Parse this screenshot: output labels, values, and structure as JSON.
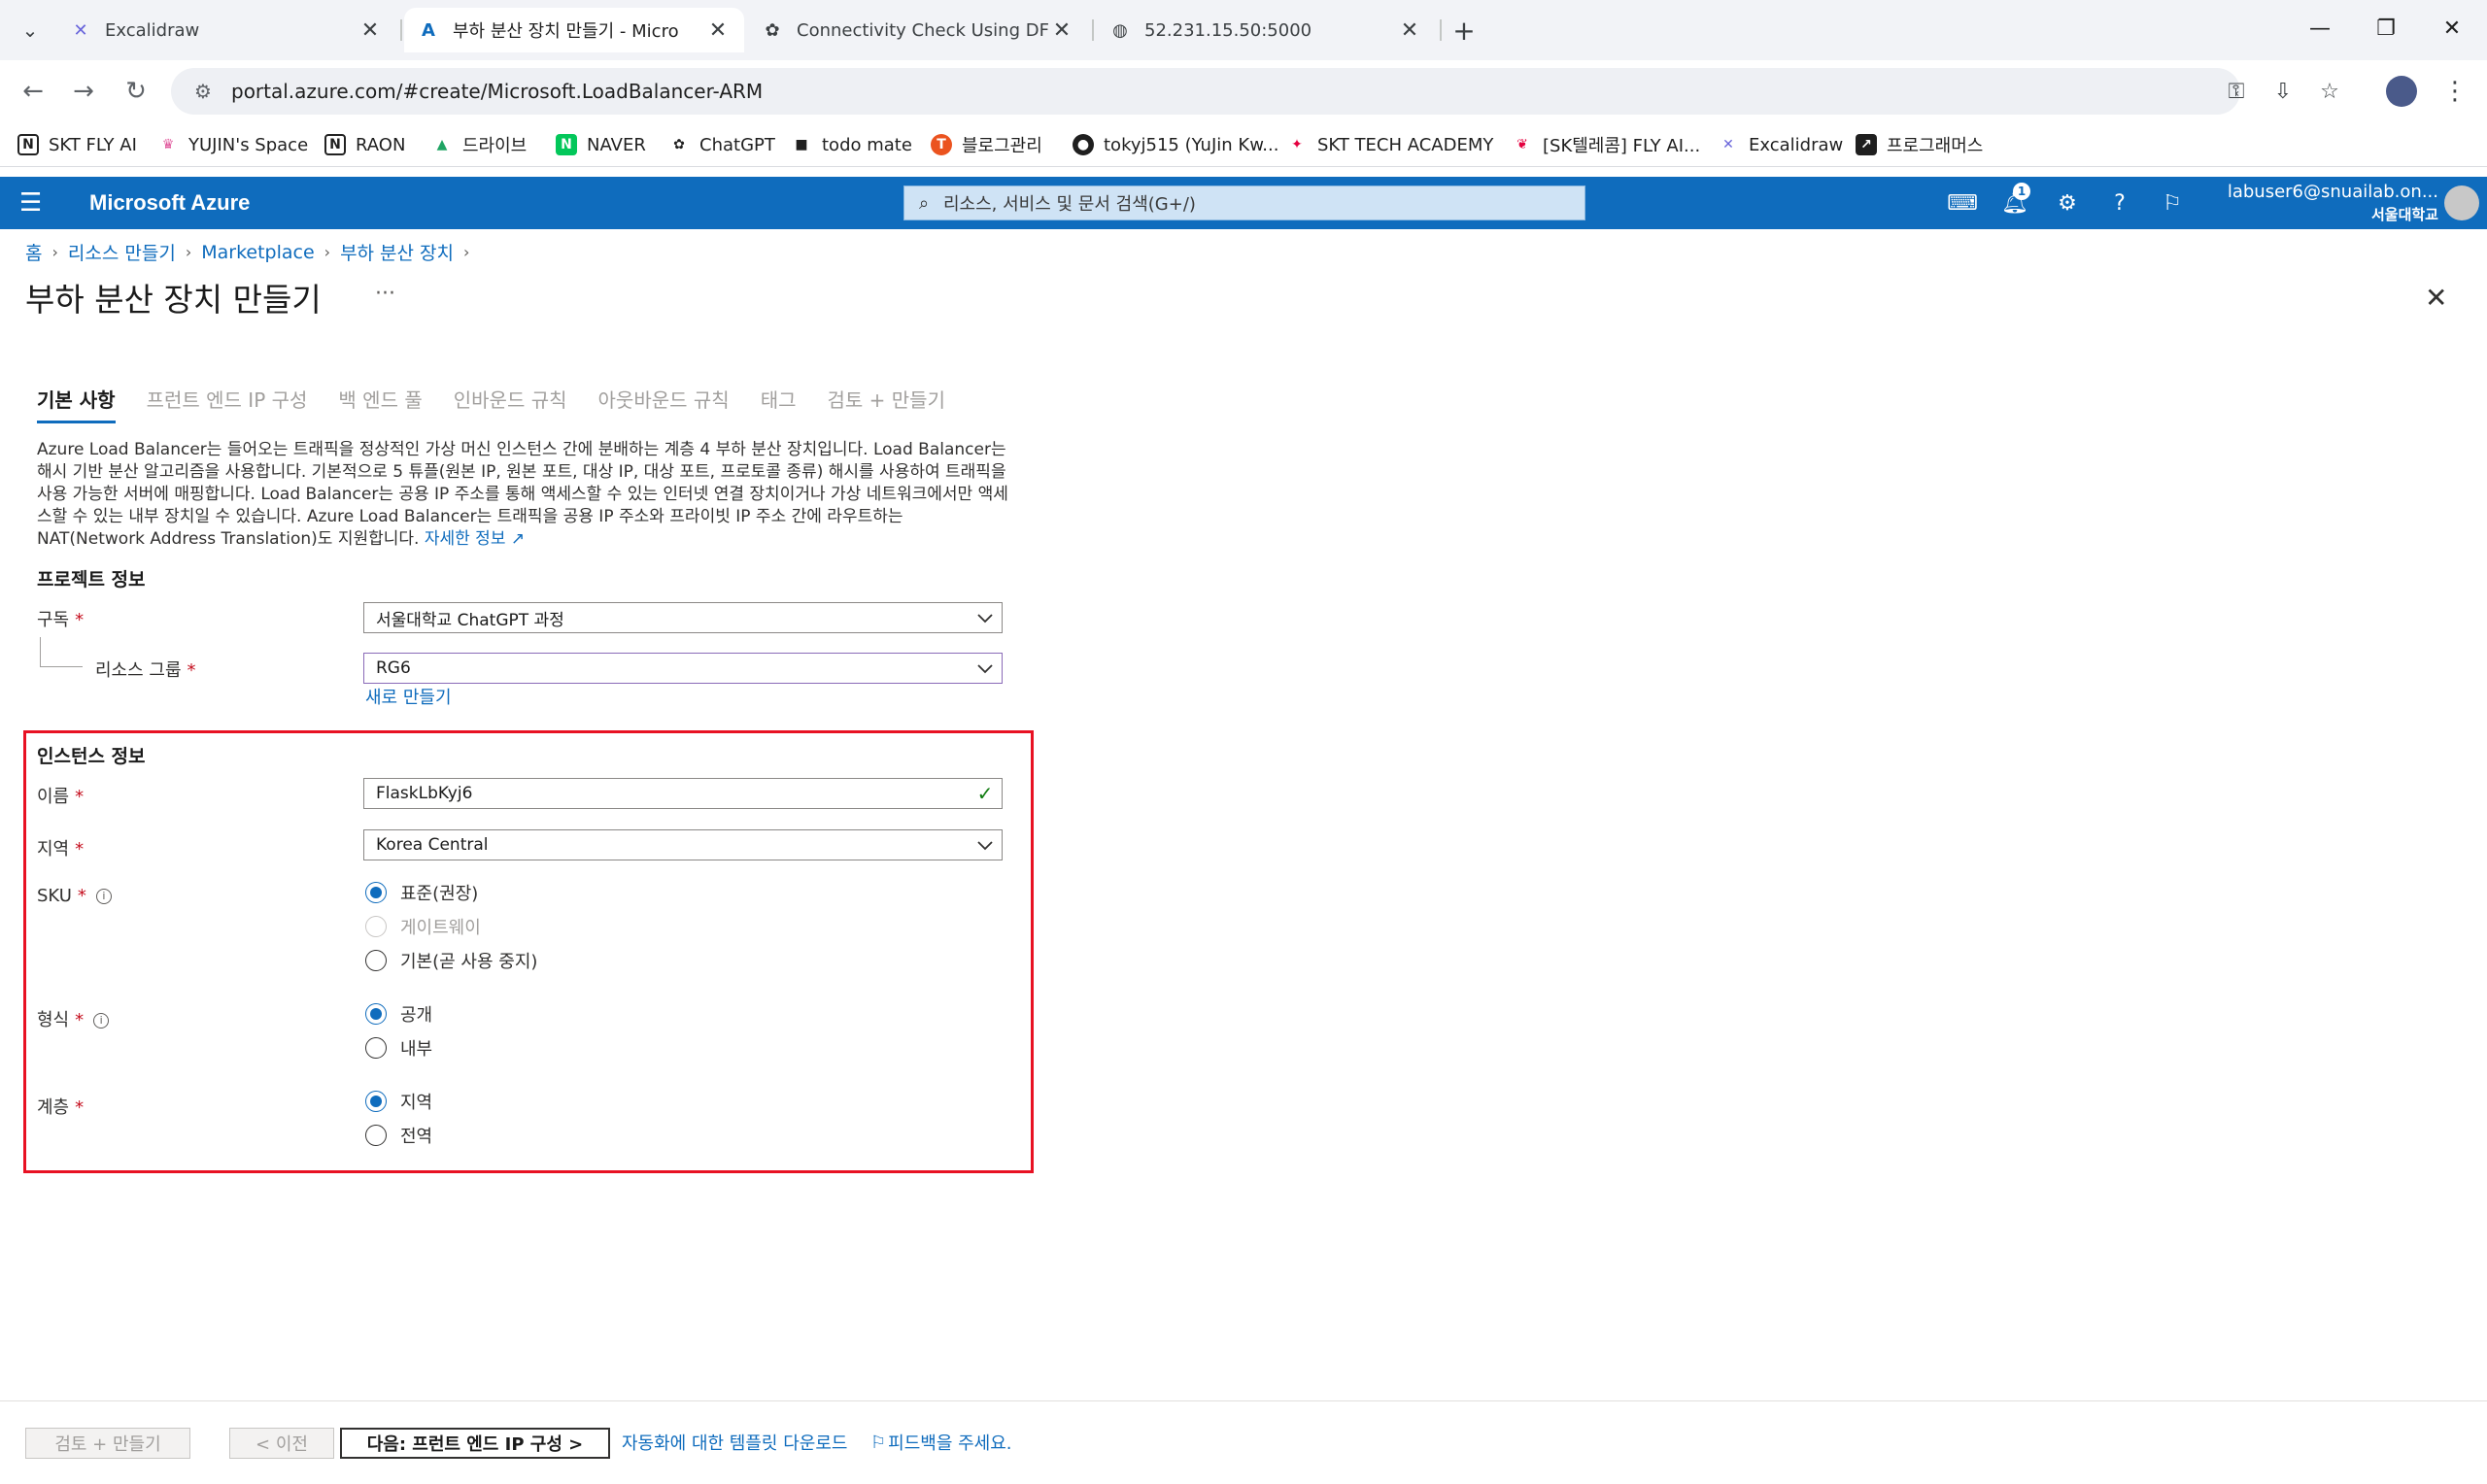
{
  "browser": {
    "tabs": [
      {
        "title": "Excalidraw",
        "icon": "excalidraw-icon"
      },
      {
        "title": "부하 분산 장치 만들기 - Micro",
        "icon": "azure-icon"
      },
      {
        "title": "Connectivity Check Using DFS",
        "icon": "openai-icon"
      },
      {
        "title": "52.231.15.50:5000",
        "icon": "globe-icon"
      }
    ],
    "url": "portal.azure.com/#create/Microsoft.LoadBalancer-ARM",
    "bookmarks": [
      "SKT FLY AI",
      "YUJIN's Space",
      "RAON",
      "드라이브",
      "NAVER",
      "ChatGPT",
      "todo mate",
      "블로그관리",
      "tokyj515 (YuJin Kw...",
      "SKT TECH ACADEMY",
      "[SK텔레콤] FLY AI...",
      "Excalidraw",
      "프로그래머스"
    ]
  },
  "azure": {
    "brand": "Microsoft Azure",
    "search_placeholder": "리소스, 서비스 및 문서 검색(G+/)",
    "notification_count": "1",
    "user_email": "labuser6@snuailab.on...",
    "user_org": "서울대학교"
  },
  "breadcrumb": [
    "홈",
    "리소스 만들기",
    "Marketplace",
    "부하 분산 장치"
  ],
  "page": {
    "title": "부하 분산 장치 만들기",
    "more": "···"
  },
  "tabs": [
    "기본 사항",
    "프런트 엔드 IP 구성",
    "백 엔드 풀",
    "인바운드 규칙",
    "아웃바운드 규칙",
    "태그",
    "검토 + 만들기"
  ],
  "description": {
    "text": "Azure Load Balancer는 들어오는 트래픽을 정상적인 가상 머신 인스턴스 간에 분배하는 계층 4 부하 분산 장치입니다. Load Balancer는 해시 기반 분산 알고리즘을 사용합니다. 기본적으로 5 튜플(원본 IP, 원본 포트, 대상 IP, 대상 포트, 프로토콜 종류) 해시를 사용하여 트래픽을 사용 가능한 서버에 매핑합니다. Load Balancer는 공용 IP 주소를 통해 액세스할 수 있는 인터넷 연결 장치이거나 가상 네트워크에서만 액세스할 수 있는 내부 장치일 수 있습니다. Azure Load Balancer는 트래픽을 공용 IP 주소와 프라이빗 IP 주소 간에 라우트하는 NAT(Network Address Translation)도 지원합니다.",
    "link": "자세한 정보"
  },
  "project": {
    "section_title": "프로젝트 정보",
    "subscription_label": "구독",
    "subscription_value": "서울대학교 ChatGPT 과정",
    "rg_label": "리소스 그룹",
    "rg_value": "RG6",
    "create_new": "새로 만들기"
  },
  "instance": {
    "section_title": "인스턴스 정보",
    "name_label": "이름",
    "name_value": "FlaskLbKyj6",
    "region_label": "지역",
    "region_value": "Korea Central",
    "sku_label": "SKU",
    "sku_options": [
      {
        "label": "표준(권장)",
        "selected": true,
        "disabled": false
      },
      {
        "label": "게이트웨이",
        "selected": false,
        "disabled": true
      },
      {
        "label": "기본(곧 사용 중지)",
        "selected": false,
        "disabled": false
      }
    ],
    "type_label": "형식",
    "type_options": [
      {
        "label": "공개",
        "selected": true
      },
      {
        "label": "내부",
        "selected": false
      }
    ],
    "tier_label": "계층",
    "tier_options": [
      {
        "label": "지역",
        "selected": true
      },
      {
        "label": "전역",
        "selected": false
      }
    ],
    "required_mark": "*"
  },
  "footer": {
    "review_create": "검토 + 만들기",
    "previous": "< 이전",
    "next": "다음: 프런트 엔드 IP 구성 >",
    "download_template": "자동화에 대한 템플릿 다운로드",
    "feedback": "피드백을 주세요."
  },
  "colors": {
    "azure_blue": "#0f6cbd",
    "highlight_red": "#e81123",
    "required_red": "#c50f1f"
  }
}
